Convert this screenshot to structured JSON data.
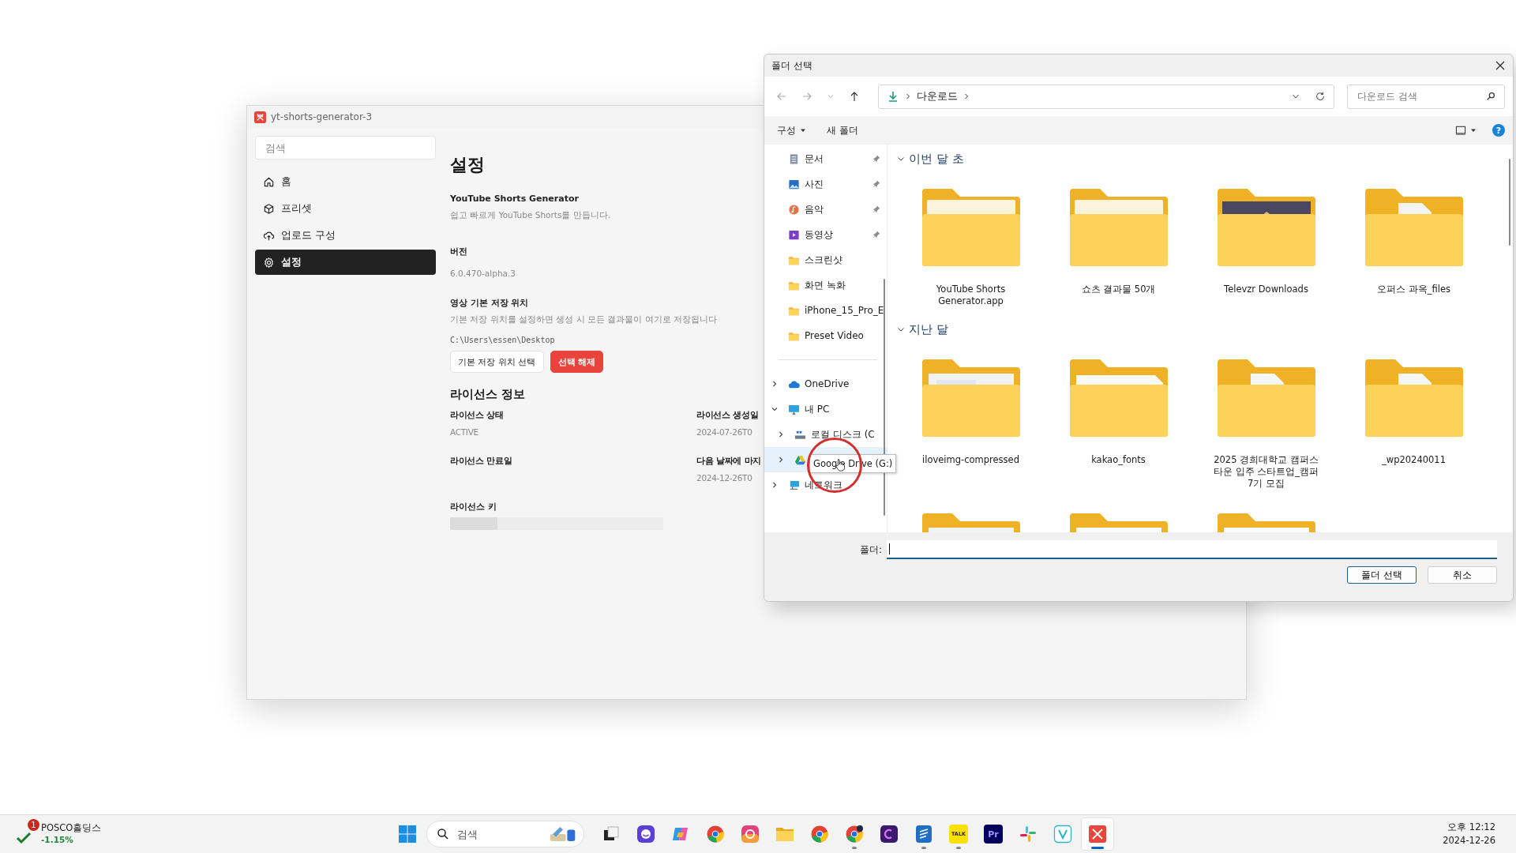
{
  "app_window": {
    "title": "yt-shorts-generator-3",
    "sidebar": {
      "search_placeholder": "검색",
      "items": [
        {
          "label": "홈",
          "kind": "home",
          "selected": false
        },
        {
          "label": "프리셋",
          "kind": "preset",
          "selected": false
        },
        {
          "label": "업로드 구성",
          "kind": "upload",
          "selected": false
        },
        {
          "label": "설정",
          "kind": "settings",
          "selected": true
        }
      ]
    },
    "page_title": "설정",
    "about": {
      "name": "YouTube Shorts Generator",
      "description": "쉽고 빠르게 YouTube Shorts를 만듭니다."
    },
    "version": {
      "label": "버전",
      "value": "6.0.470-alpha.3"
    },
    "save_location": {
      "label": "영상 기본 저장 위치",
      "description": "기본 저장 위치를 설정하면 생성 시 모든 결과물이 여기로 저장됩니다",
      "path": "C:\\Users\\essen\\Desktop",
      "buttons": [
        {
          "label": "기본 저장 위치 선택",
          "kind": "secondary"
        },
        {
          "label": "선택 해제",
          "kind": "danger"
        }
      ]
    },
    "license": {
      "title": "라이선스 정보",
      "fields": [
        {
          "label": "라이선스 상태",
          "value": "ACTIVE"
        },
        {
          "label": "라이선스 생성일",
          "value": "2024-07-26T0"
        },
        {
          "label": "라이선스 만료일"
        },
        {
          "label": "다음 날짜에 마지",
          "value": "2024-12-26T0"
        }
      ],
      "key_label": "라이선스 키",
      "key_loading": true
    }
  },
  "dialog": {
    "title": "폴더 선택",
    "address": {
      "location": "다운로드"
    },
    "search": {
      "placeholder": "다운로드 검색"
    },
    "commands": [
      {
        "label": "구성",
        "dropdown": true
      },
      {
        "label": "새 폴더",
        "dropdown": false
      }
    ],
    "help": "?",
    "quick_access": [
      {
        "label": "문서",
        "kind": "documents",
        "pinned": true
      },
      {
        "label": "사진",
        "kind": "pictures",
        "pinned": true
      },
      {
        "label": "음악",
        "kind": "music",
        "pinned": true
      },
      {
        "label": "동영상",
        "kind": "videos",
        "pinned": true
      },
      {
        "label": "스크린샷",
        "kind": "folder",
        "pinned": false
      },
      {
        "label": "화면 녹화",
        "kind": "folder",
        "pinned": false
      },
      {
        "label": "iPhone_15_Pro_E",
        "kind": "folder",
        "pinned": false
      },
      {
        "label": "Preset Video",
        "kind": "folder",
        "pinned": false
      }
    ],
    "tree": [
      {
        "label": "OneDrive",
        "kind": "cloud",
        "expanded": false,
        "hovered": false
      },
      {
        "label": "내 PC",
        "kind": "pc",
        "expanded": true,
        "hovered": false,
        "children": [
          {
            "label": "로컬 디스크 (C",
            "kind": "disk",
            "expanded": false,
            "hovered": false
          },
          {
            "kind": "drive",
            "expanded": false,
            "hovered": true
          }
        ]
      },
      {
        "label": "네트워크",
        "kind": "network",
        "expanded": false,
        "hovered": false
      }
    ],
    "tooltip": "Google Drive (G:)",
    "groups": [
      {
        "title": "이번 달 초",
        "expanded": true,
        "items": [
          {
            "name": "YouTube Shorts Generator.app",
            "kind": "plain"
          },
          {
            "name": "쇼츠 결과물 50개",
            "kind": "plain"
          },
          {
            "name": "Televzr Downloads",
            "kind": "picture"
          },
          {
            "name": "오퍼스 과옥_files",
            "kind": "file"
          }
        ]
      },
      {
        "title": "지난 달",
        "expanded": true,
        "items": [
          {
            "name": "iloveimg-compressed",
            "kind": "screenshot"
          },
          {
            "name": "kakao_fonts",
            "kind": "text"
          },
          {
            "name": "2025 경희대학교 캠퍼스타운 입주 스타트업_캠퍼7기 모집",
            "kind": "spreadsheet"
          },
          {
            "name": "_wp20240011",
            "kind": "pdf"
          },
          {
            "kind": "screenshot"
          },
          {
            "kind": "document"
          },
          {
            "kind": "document"
          }
        ]
      }
    ],
    "folder_field": {
      "label": "폴더:"
    },
    "buttons": [
      {
        "label": "폴더 선택",
        "default": true
      },
      {
        "label": "취소",
        "default": false
      }
    ]
  },
  "taskbar": {
    "widget": {
      "badge": "1",
      "name": "POSCO홀딩스",
      "change": "-1.15%"
    },
    "search_placeholder": "검색",
    "apps": [
      {
        "kind": "task-view",
        "running": false,
        "active": false
      },
      {
        "kind": "chat",
        "running": false,
        "active": false
      },
      {
        "kind": "swirl",
        "running": false,
        "active": false
      },
      {
        "kind": "browser",
        "running": false,
        "active": false
      },
      {
        "kind": "camera",
        "running": false,
        "active": false
      },
      {
        "kind": "folder",
        "running": false,
        "active": false
      },
      {
        "kind": "browser",
        "running": false,
        "active": false
      },
      {
        "kind": "browser-badge",
        "running": true,
        "active": false
      },
      {
        "kind": "purple",
        "running": false,
        "active": false
      },
      {
        "kind": "notes",
        "running": true,
        "active": false
      },
      {
        "kind": "talk",
        "label": "TALK",
        "running": true,
        "active": false
      },
      {
        "kind": "editor",
        "label": "Pr",
        "running": false,
        "active": false
      },
      {
        "kind": "slack",
        "running": false,
        "active": false
      },
      {
        "kind": "vee",
        "running": false,
        "active": false
      },
      {
        "kind": "red",
        "running": true,
        "active": true
      }
    ],
    "clock": {
      "time": "오후 12:12",
      "date": "2024-12-26"
    }
  }
}
